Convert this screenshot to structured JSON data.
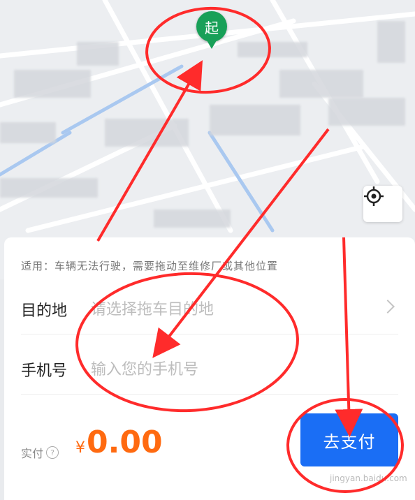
{
  "map": {
    "start_pin_label": "起",
    "locate_icon": "crosshair-icon"
  },
  "form": {
    "hint": "适用：车辆无法行驶，需要拖动至维修厂或其他位置",
    "destination_label": "目的地",
    "destination_placeholder": "请选择拖车目的地",
    "phone_label": "手机号",
    "phone_placeholder": "输入您的手机号"
  },
  "payment": {
    "label": "实付",
    "currency": "¥",
    "amount": "0.00",
    "button": "去支付"
  },
  "watermark": "jingyan.baidu.com",
  "colors": {
    "accent": "#1a6ef5",
    "price": "#ff6a10",
    "pin": "#18a058",
    "annotation": "#ff2b2b"
  }
}
